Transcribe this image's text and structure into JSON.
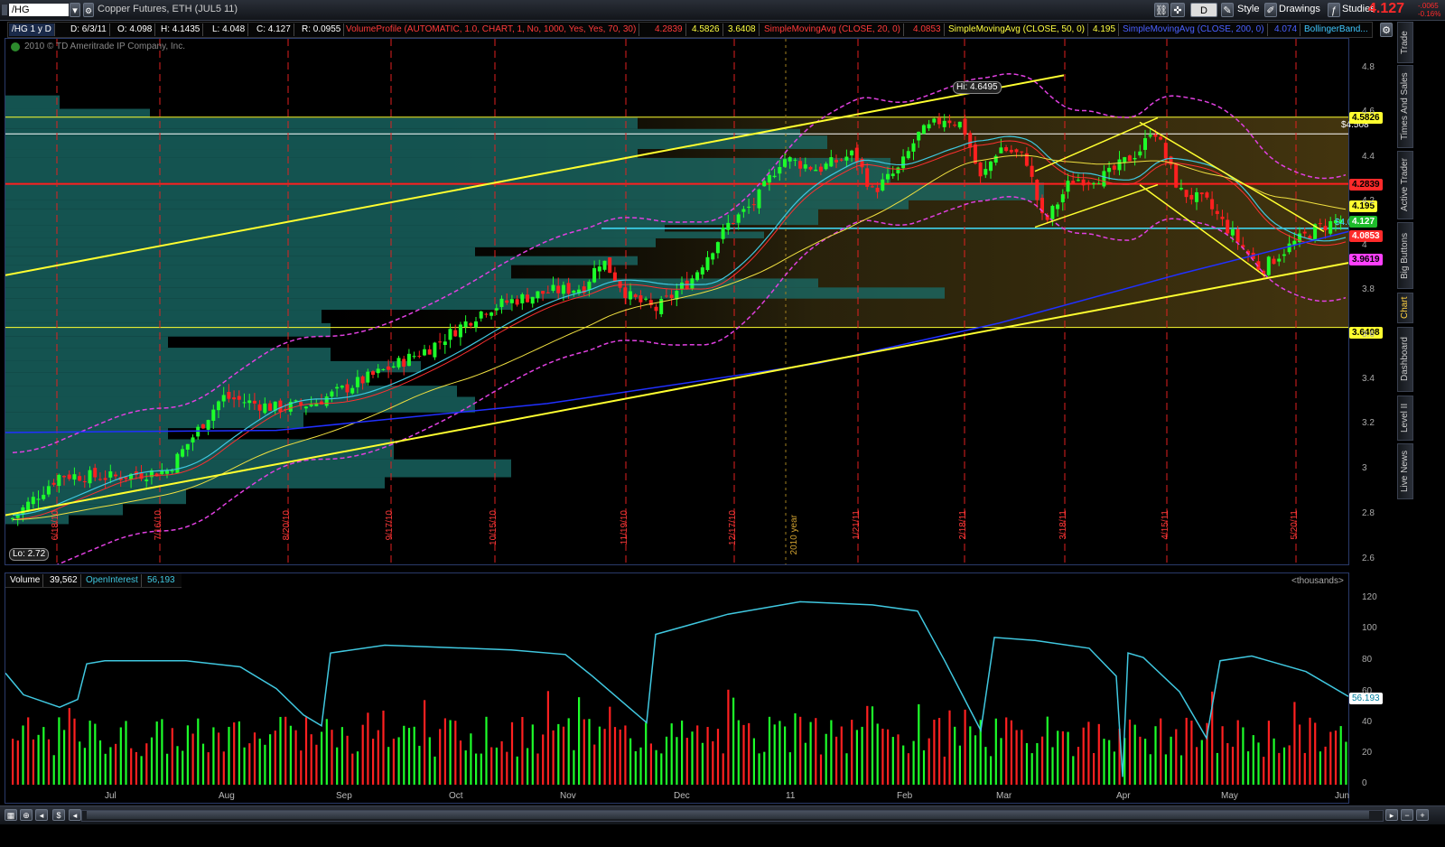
{
  "toolbar": {
    "symbol": "/HG",
    "description": "Copper Futures, ETH (JUL5 11)",
    "d_button": "D",
    "style_label": "Style",
    "drawings_label": "Drawings",
    "studies_label": "Studies",
    "last_price": "4.127",
    "change_top": "-.0065",
    "change_bottom": "-0.16%"
  },
  "infobar": {
    "period": "/HG 1 y D",
    "date": "D: 6/3/11",
    "open": "O: 4.098",
    "high": "H: 4.1435",
    "low": "L: 4.048",
    "close": "C: 4.127",
    "range": "R: 0.0955",
    "volume_profile": "VolumeProfile (AUTOMATIC, 1.0, CHART, 1, No, 1000, Yes, Yes, 70, 30)",
    "vp_v1": "4.2839",
    "vp_v2": "4.5826",
    "vp_v3": "3.6408",
    "sma20": "SimpleMovingAvg (CLOSE, 20, 0)",
    "sma20_val": "4.0853",
    "sma50": "SimpleMovingAvg (CLOSE, 50, 0)",
    "sma50_val": "4.195",
    "sma200": "SimpleMovingAvg (CLOSE, 200, 0)",
    "sma200_val": "4.074",
    "bollinger": "BollingerBand..."
  },
  "chart_meta": {
    "copyright": "2010 © TD Ameritrade IP Company, Inc.",
    "hi_label": "Hi: 4.6495",
    "lo_label": "Lo: 2.72",
    "resistance_label": "$4.508",
    "current_line_label": "$4.0846",
    "year_label": "2010 year"
  },
  "colors": {
    "up": "#1dff2a",
    "down": "#ff2020",
    "sma20": "#ff3030",
    "sma50": "#f0e040",
    "sma200": "#2030ff",
    "bollinger": "#e040e0",
    "trend": "#ffff30",
    "oi": "#40c8e0"
  },
  "side_tabs": [
    "Trade",
    "Times And Sales",
    "Active Trader",
    "Big Buttons",
    "Chart",
    "Dashboard",
    "Level II",
    "Live News"
  ],
  "lower": {
    "volume_label": "Volume",
    "volume_val": "39,562",
    "oi_label": "OpenInterest",
    "oi_val": "56,193",
    "units": "<thousands>",
    "oi_price_label": "56.193"
  },
  "upper_ticks": [
    "4.8",
    "4.6",
    "4.4",
    "4.2",
    "4",
    "3.8",
    "3.6",
    "3.4",
    "3.2",
    "3",
    "2.8",
    "2.6"
  ],
  "lower_ticks": [
    "120",
    "100",
    "80",
    "60",
    "40",
    "20",
    "0"
  ],
  "price_labels": {
    "p4_5826": "4.5826",
    "p4_2839": "4.2839",
    "p4_195": "4.195",
    "p4_127": "4.127",
    "p4_0853": "4.0853",
    "p3_9619": "3.9619",
    "p3_6408": "3.6408"
  },
  "month_labels": [
    "Jul",
    "Aug",
    "Sep",
    "Oct",
    "Nov",
    "Dec",
    "11",
    "Feb",
    "Mar",
    "Apr",
    "May",
    "Jun"
  ],
  "date_labels": [
    "6/18/10",
    "7/16/10",
    "8/20/10",
    "9/17/10",
    "10/15/10",
    "11/19/10",
    "12/17/10",
    "1/21/11",
    "2/18/11",
    "3/18/11",
    "4/15/11",
    "5/20/11"
  ],
  "chart_data": {
    "type": "candlestick",
    "title": "Copper Futures, ETH (JUL5 11)",
    "period": "1 year daily",
    "ylim": [
      2.6,
      4.85
    ],
    "hi": 4.6495,
    "lo": 2.72,
    "last": {
      "date": "6/3/11",
      "open": 4.098,
      "high": 4.1435,
      "low": 4.048,
      "close": 4.127,
      "volume": 39562,
      "open_interest": 56193
    },
    "close_path_approx": [
      [
        "6/11/10",
        2.78
      ],
      [
        "6/25/10",
        2.98
      ],
      [
        "7/9/10",
        2.95
      ],
      [
        "7/23/10",
        3.02
      ],
      [
        "8/6/10",
        3.35
      ],
      [
        "8/20/10",
        3.26
      ],
      [
        "9/3/10",
        3.45
      ],
      [
        "9/17/10",
        3.5
      ],
      [
        "10/1/10",
        3.68
      ],
      [
        "10/15/10",
        3.8
      ],
      [
        "10/29/10",
        3.79
      ],
      [
        "11/12/10",
        3.95
      ],
      [
        "11/19/10",
        3.75
      ],
      [
        "12/3/10",
        3.8
      ],
      [
        "12/17/10",
        4.2
      ],
      [
        "12/31/10",
        4.4
      ],
      [
        "1/14/11",
        4.35
      ],
      [
        "1/28/11",
        4.42
      ],
      [
        "2/11/11",
        4.56
      ],
      [
        "2/18/11",
        4.45
      ],
      [
        "3/4/11",
        4.45
      ],
      [
        "3/18/11",
        4.3
      ],
      [
        "4/1/11",
        4.35
      ],
      [
        "4/11/11",
        4.53
      ],
      [
        "4/22/11",
        4.25
      ],
      [
        "5/5/11",
        3.95
      ],
      [
        "5/13/11",
        3.9
      ],
      [
        "5/27/11",
        4.1
      ],
      [
        "6/3/11",
        4.127
      ]
    ],
    "volume_profile_levels": {
      "poc": 4.2839,
      "value_area_high": 4.5826,
      "value_area_low": 3.6408
    },
    "moving_averages": {
      "sma20": 4.0853,
      "sma50": 4.195,
      "sma200": 4.074
    },
    "horizontal_lines": [
      4.5826,
      4.508,
      4.2839,
      4.0846,
      3.6408
    ],
    "lower_ylim": [
      0,
      125
    ],
    "open_interest_last": 56.193,
    "lower_units": "thousands"
  }
}
